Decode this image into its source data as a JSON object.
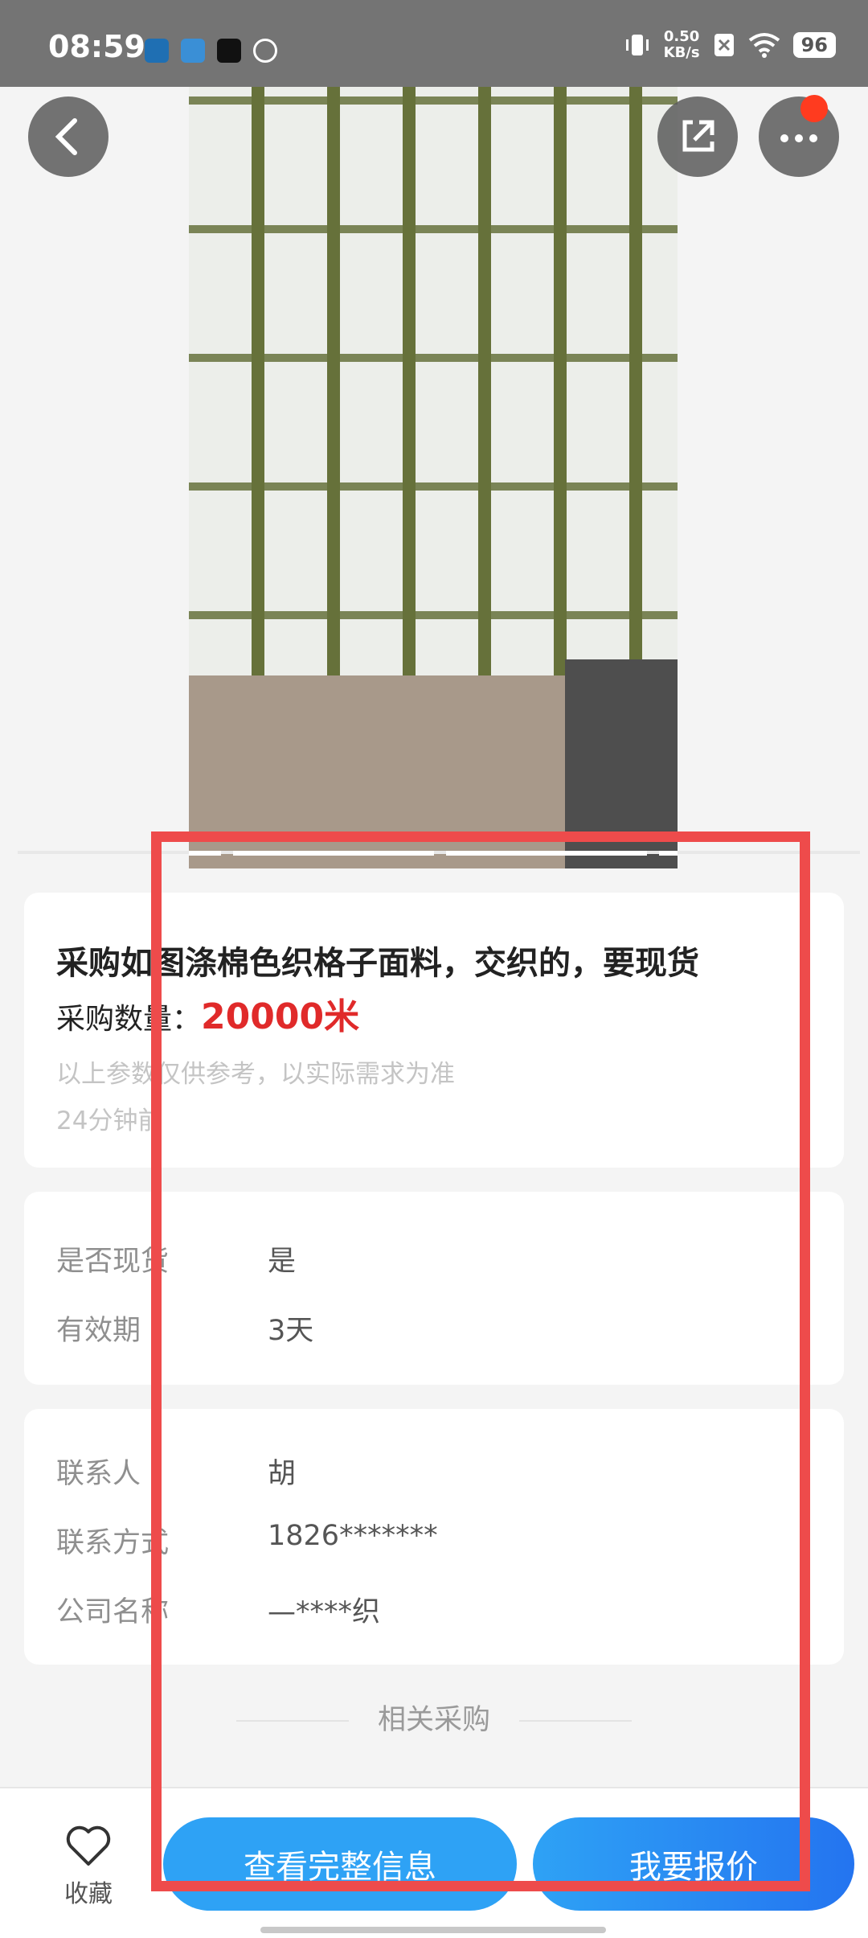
{
  "status_bar": {
    "time": "08:59",
    "net_speed_value": "0.50",
    "net_speed_unit": "KB/s",
    "battery": "96"
  },
  "info": {
    "title": "采购如图涤棉色织格子面料，交织的，要现货",
    "qty_label": "采购数量：",
    "qty_value": "20000米",
    "note": "以上参数仅供参考，以实际需求为准",
    "posted": "24分钟前"
  },
  "details": [
    {
      "label": "是否现货",
      "value": "是"
    },
    {
      "label": "有效期",
      "value": "3天"
    }
  ],
  "contact": [
    {
      "label": "联系人",
      "value": "胡"
    },
    {
      "label": "联系方式",
      "value": "1826*******"
    },
    {
      "label": "公司名称",
      "value": "—****织"
    }
  ],
  "related_label": "相关采购",
  "bottom": {
    "favorite_label": "收藏",
    "view_full_button": "查看完整信息",
    "quote_button": "我要报价"
  },
  "colors": {
    "accent_blue": "#2ea2f5",
    "price_red": "#e02a2a",
    "annotation_red": "#ee4b4b"
  }
}
